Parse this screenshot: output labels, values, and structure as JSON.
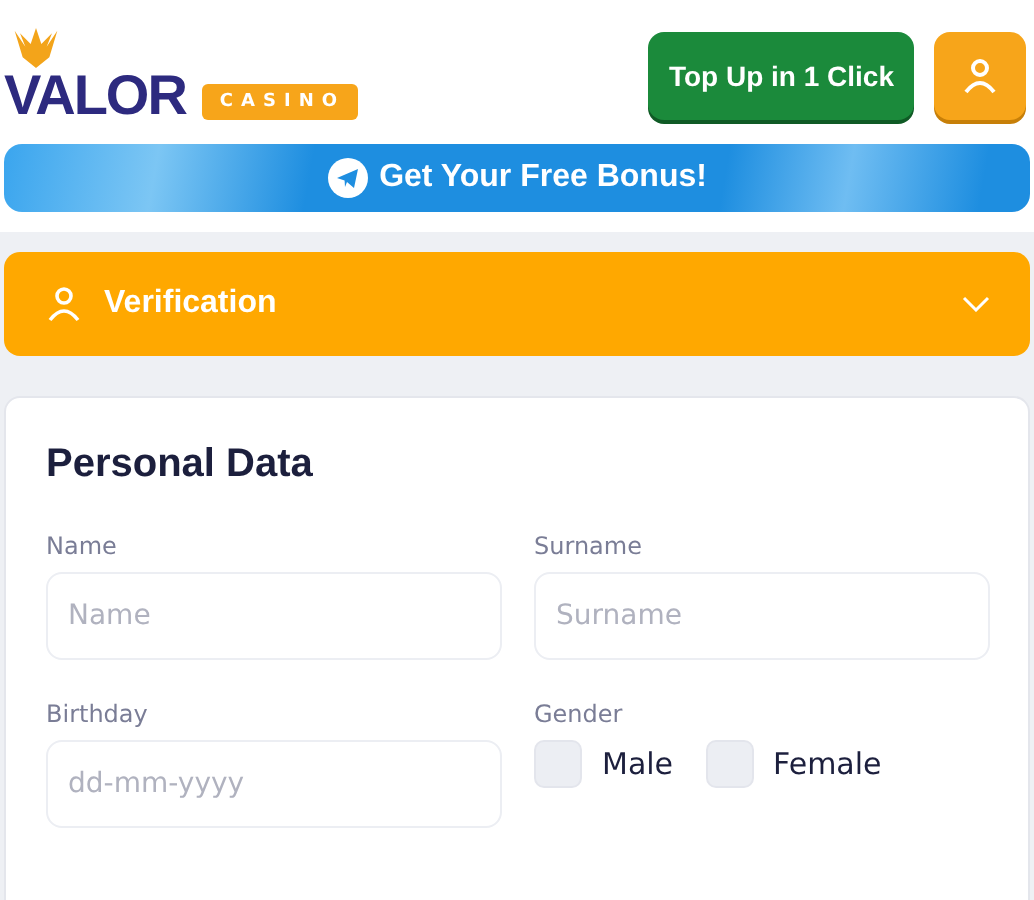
{
  "header": {
    "logo": {
      "name": "VALOR",
      "tag": "CASINO"
    },
    "top_up_button": "Top Up in 1 Click"
  },
  "banner": {
    "label": "Get Your Free Bonus!"
  },
  "verification": {
    "title": "Verification",
    "expanded": false
  },
  "personal_data": {
    "title": "Personal Data",
    "fields": [
      {
        "label": "Name",
        "placeholder": "Name"
      },
      {
        "label": "Surname",
        "placeholder": "Surname"
      },
      {
        "label": "Birthday",
        "placeholder": "dd-mm-yyyy"
      }
    ],
    "gender": {
      "label": "Gender",
      "options": [
        {
          "label": "Male",
          "checked": false
        },
        {
          "label": "Female",
          "checked": false
        }
      ]
    }
  }
}
